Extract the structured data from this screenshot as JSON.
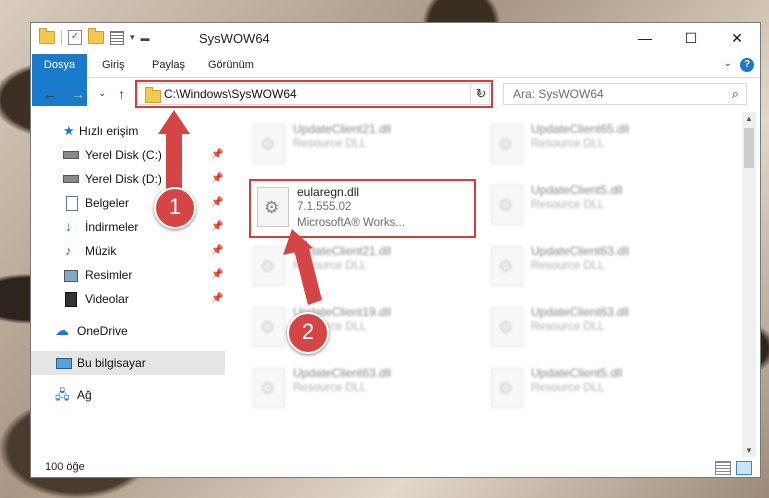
{
  "window": {
    "title": "SysWOW64",
    "minimize_glyph": "—",
    "maximize_glyph": "☐",
    "close_glyph": "✕"
  },
  "ribbon": {
    "tabs": [
      "Dosya",
      "Giriş",
      "Paylaş",
      "Görünüm"
    ],
    "help": "?",
    "expand_glyph": "⌄"
  },
  "nav": {
    "back": "←",
    "forward": "→",
    "recent": "⌄",
    "up": "↑",
    "address": "C:\\Windows\\SysWOW64",
    "refresh": "↻",
    "search_placeholder": "Ara: SysWOW64",
    "search_icon": "search-icon"
  },
  "sidebar": {
    "items": [
      {
        "label": "Hızlı erişim",
        "icon": "star-icon",
        "pinned": false
      },
      {
        "label": "Yerel Disk (C:)",
        "icon": "drive-icon",
        "pinned": true
      },
      {
        "label": "Yerel Disk (D:)",
        "icon": "drive-icon",
        "pinned": true
      },
      {
        "label": "Belgeler",
        "icon": "document-icon",
        "pinned": true
      },
      {
        "label": "İndirmeler",
        "icon": "download-icon",
        "pinned": true
      },
      {
        "label": "Müzik",
        "icon": "music-icon",
        "pinned": true
      },
      {
        "label": "Resimler",
        "icon": "pictures-icon",
        "pinned": true
      },
      {
        "label": "Videolar",
        "icon": "video-icon",
        "pinned": true
      },
      {
        "label": "OneDrive",
        "icon": "cloud-icon",
        "pinned": false
      },
      {
        "label": "Bu bilgisayar",
        "icon": "computer-icon",
        "pinned": false,
        "selected": true
      },
      {
        "label": "Ağ",
        "icon": "network-icon",
        "pinned": false
      }
    ],
    "pin_glyph": "📌"
  },
  "files": {
    "focus": {
      "name": "eularegn.dll",
      "version": "7.1.555.02",
      "company": "MicrosoftA® Works..."
    },
    "left_col": [
      {
        "name": "UpdateClient21.dll",
        "type": "Resource DLL"
      },
      {
        "name": "UpdateClient21.dll",
        "type": "Resource DLL"
      },
      {
        "name": "UpdateClient19.dll",
        "type": "Resource DLL"
      },
      {
        "name": "UpdateClient63.dll",
        "type": "Resource DLL"
      }
    ],
    "right_col": [
      {
        "name": "UpdateClient65.dll",
        "type": "Resource DLL"
      },
      {
        "name": "UpdateClient5.dll",
        "type": "Resource DLL"
      },
      {
        "name": "UpdateClient63.dll",
        "type": "Resource DLL"
      },
      {
        "name": "UpdateClient63.dll",
        "type": "Resource DLL"
      },
      {
        "name": "UpdateClient5.dll",
        "type": "Resource DLL"
      }
    ]
  },
  "status": {
    "count": "100 öğe"
  },
  "annotations": {
    "badge1": "1",
    "badge2": "2",
    "color": "#d64545"
  }
}
